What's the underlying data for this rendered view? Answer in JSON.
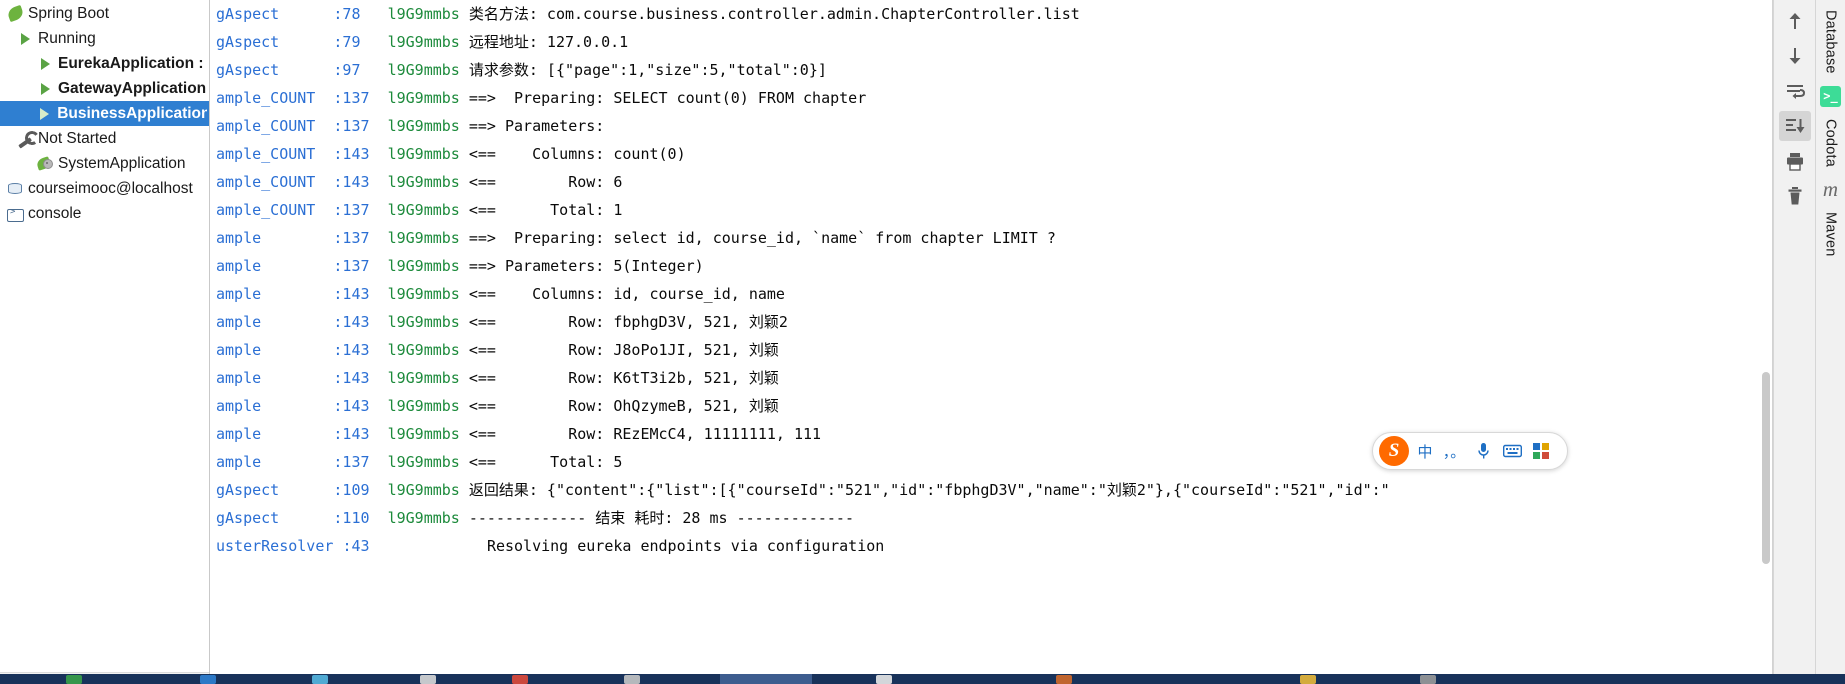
{
  "services_tree": {
    "name": "services-tree",
    "rows": [
      {
        "label": "Spring Boot",
        "indent": 0,
        "icon": "spring-leaf-icon",
        "bold": false,
        "selected": false
      },
      {
        "label": "Running",
        "indent": 1,
        "icon": "run-triangle-icon",
        "bold": false,
        "selected": false
      },
      {
        "label": "EurekaApplication :",
        "indent": 2,
        "icon": "run-triangle-icon",
        "bold": true,
        "selected": false
      },
      {
        "label": "GatewayApplication",
        "indent": 2,
        "icon": "run-triangle-icon",
        "bold": true,
        "selected": false
      },
      {
        "label": "BusinessApplication",
        "indent": 2,
        "icon": "run-triangle-icon",
        "bold": true,
        "selected": true
      },
      {
        "label": "Not Started",
        "indent": 1,
        "icon": "wrench-icon",
        "bold": false,
        "selected": false
      },
      {
        "label": "SystemApplication",
        "indent": 2,
        "icon": "spring-gear-icon",
        "bold": false,
        "selected": false
      },
      {
        "label": "courseimooc@localhost",
        "indent": 0,
        "icon": "database-icon",
        "bold": false,
        "selected": false
      },
      {
        "label": "console",
        "indent": 0,
        "icon": "console-icon",
        "bold": false,
        "selected": false
      }
    ]
  },
  "console": {
    "name": "run-console-output",
    "lines": [
      {
        "logger": "gAspect",
        "line_no": ":78",
        "thread": "l9G9mmbs",
        "message": "类名方法: com.course.business.controller.admin.ChapterController.list"
      },
      {
        "logger": "gAspect",
        "line_no": ":79",
        "thread": "l9G9mmbs",
        "message": "远程地址: 127.0.0.1"
      },
      {
        "logger": "gAspect",
        "line_no": ":97",
        "thread": "l9G9mmbs",
        "message": "请求参数: [{\"page\":1,\"size\":5,\"total\":0}]"
      },
      {
        "logger": "ample_COUNT",
        "line_no": ":137",
        "thread": "l9G9mmbs",
        "message": "==>  Preparing: SELECT count(0) FROM chapter"
      },
      {
        "logger": "ample_COUNT",
        "line_no": ":137",
        "thread": "l9G9mmbs",
        "message": "==> Parameters:"
      },
      {
        "logger": "ample_COUNT",
        "line_no": ":143",
        "thread": "l9G9mmbs",
        "message": "<==    Columns: count(0)"
      },
      {
        "logger": "ample_COUNT",
        "line_no": ":143",
        "thread": "l9G9mmbs",
        "message": "<==        Row: 6"
      },
      {
        "logger": "ample_COUNT",
        "line_no": ":137",
        "thread": "l9G9mmbs",
        "message": "<==      Total: 1"
      },
      {
        "logger": "ample",
        "line_no": ":137",
        "thread": "l9G9mmbs",
        "message": "==>  Preparing: select id, course_id, `name` from chapter LIMIT ?"
      },
      {
        "logger": "ample",
        "line_no": ":137",
        "thread": "l9G9mmbs",
        "message": "==> Parameters: 5(Integer)"
      },
      {
        "logger": "ample",
        "line_no": ":143",
        "thread": "l9G9mmbs",
        "message": "<==    Columns: id, course_id, name"
      },
      {
        "logger": "ample",
        "line_no": ":143",
        "thread": "l9G9mmbs",
        "message": "<==        Row: fbphgD3V, 521, 刘颖2"
      },
      {
        "logger": "ample",
        "line_no": ":143",
        "thread": "l9G9mmbs",
        "message": "<==        Row: J8oPo1JI, 521, 刘颖"
      },
      {
        "logger": "ample",
        "line_no": ":143",
        "thread": "l9G9mmbs",
        "message": "<==        Row: K6tT3i2b, 521, 刘颖"
      },
      {
        "logger": "ample",
        "line_no": ":143",
        "thread": "l9G9mmbs",
        "message": "<==        Row: OhQzymeB, 521, 刘颖"
      },
      {
        "logger": "ample",
        "line_no": ":143",
        "thread": "l9G9mmbs",
        "message": "<==        Row: REzEMcC4, 11111111, 111"
      },
      {
        "logger": "ample",
        "line_no": ":137",
        "thread": "l9G9mmbs",
        "message": "<==      Total: 5"
      },
      {
        "logger": "gAspect",
        "line_no": ":109",
        "thread": "l9G9mmbs",
        "message": "返回结果: {\"content\":{\"list\":[{\"courseId\":\"521\",\"id\":\"fbphgD3V\",\"name\":\"刘颖2\"},{\"courseId\":\"521\",\"id\":\""
      },
      {
        "logger": "gAspect",
        "line_no": ":110",
        "thread": "l9G9mmbs",
        "message": "------------- 结束 耗时: 28 ms -------------"
      },
      {
        "logger": "usterResolver",
        "line_no": ":43",
        "thread": "",
        "message": "Resolving eureka endpoints via configuration"
      }
    ]
  },
  "action_toolbar": {
    "name": "console-action-toolbar",
    "buttons": [
      {
        "label": "Up the Stack Trace",
        "icon": "arrow-up-icon",
        "active": false
      },
      {
        "label": "Down the Stack Trace",
        "icon": "arrow-down-icon",
        "active": false
      },
      {
        "label": "Use Soft Wraps",
        "icon": "soft-wrap-icon",
        "active": false
      },
      {
        "label": "Scroll to the End",
        "icon": "scroll-to-end-icon",
        "active": true
      },
      {
        "label": "Print",
        "icon": "printer-icon",
        "active": false
      },
      {
        "label": "Clear All",
        "icon": "trash-icon",
        "active": false
      }
    ]
  },
  "tool_tabs": {
    "name": "right-tool-window-bar",
    "tabs": [
      {
        "label": "Database",
        "icon": ""
      },
      {
        "label": "Codota",
        "icon": "codota-terminal-badge"
      },
      {
        "label": "Maven",
        "icon": "maven-m-icon"
      }
    ]
  },
  "ime_bar": {
    "name": "sogou-ime-floating-toolbar",
    "logo_text": "S",
    "items": [
      {
        "label": "中",
        "icon": "chinese-mode-icon"
      },
      {
        "label": "，。",
        "icon": "punctuation-icon"
      },
      {
        "label": "",
        "icon": "microphone-icon"
      },
      {
        "label": "",
        "icon": "keyboard-icon"
      },
      {
        "label": "",
        "icon": "app-grid-icon"
      }
    ]
  }
}
